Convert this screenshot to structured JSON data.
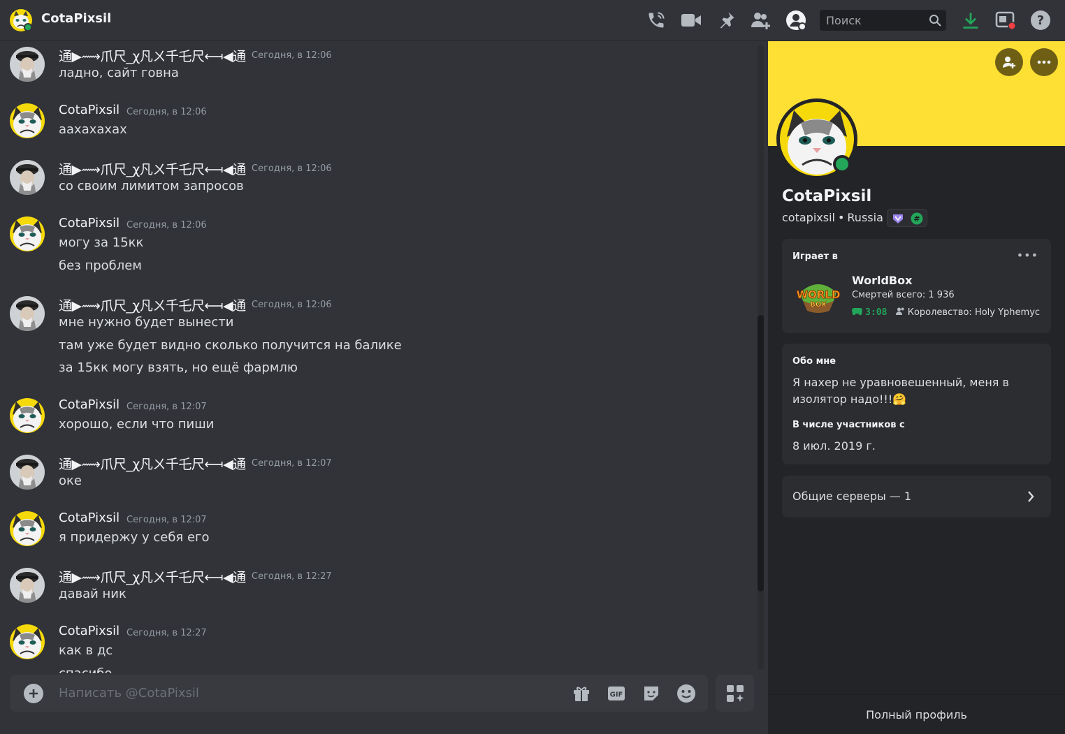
{
  "header": {
    "title": "CotaPixsil",
    "search_placeholder": "Поиск"
  },
  "messages": [
    {
      "author": "通▶⟿爪尺_χ凡ㄨ千乇尺⟻◀通",
      "fancy": true,
      "avatar": "user-photo",
      "timestamp": "Сегодня, в 12:06",
      "lines": [
        "ладно, сайт говна"
      ]
    },
    {
      "author": "CotaPixsil",
      "fancy": false,
      "avatar": "grumpy-cat",
      "timestamp": "Сегодня, в 12:06",
      "lines": [
        "аахахахах"
      ]
    },
    {
      "author": "通▶⟿爪尺_χ凡ㄨ千乇尺⟻◀通",
      "fancy": true,
      "avatar": "user-photo",
      "timestamp": "Сегодня, в 12:06",
      "lines": [
        "со своим лимитом запросов"
      ]
    },
    {
      "author": "CotaPixsil",
      "fancy": false,
      "avatar": "grumpy-cat",
      "timestamp": "Сегодня, в 12:06",
      "lines": [
        "могу за 15кк",
        "без проблем"
      ]
    },
    {
      "author": "通▶⟿爪尺_χ凡ㄨ千乇尺⟻◀通",
      "fancy": true,
      "avatar": "user-photo",
      "timestamp": "Сегодня, в 12:06",
      "lines": [
        "мне нужно будет вынести",
        "там уже будет видно сколько получится на балике",
        "за 15кк могу взять, но ещё фармлю"
      ]
    },
    {
      "author": "CotaPixsil",
      "fancy": false,
      "avatar": "grumpy-cat",
      "timestamp": "Сегодня, в 12:07",
      "lines": [
        "хорошо, если что пиши"
      ]
    },
    {
      "author": "通▶⟿爪尺_χ凡ㄨ千乇尺⟻◀通",
      "fancy": true,
      "avatar": "user-photo",
      "timestamp": "Сегодня, в 12:07",
      "lines": [
        "оке"
      ]
    },
    {
      "author": "CotaPixsil",
      "fancy": false,
      "avatar": "grumpy-cat",
      "timestamp": "Сегодня, в 12:07",
      "lines": [
        "я придержу у себя его"
      ]
    },
    {
      "author": "通▶⟿爪尺_χ凡ㄨ千乇尺⟻◀通",
      "fancy": true,
      "avatar": "user-photo",
      "timestamp": "Сегодня, в 12:27",
      "lines": [
        "давай ник"
      ]
    },
    {
      "author": "CotaPixsil",
      "fancy": false,
      "avatar": "grumpy-cat",
      "timestamp": "Сегодня, в 12:27",
      "lines": [
        "как в дс",
        "спасибо"
      ]
    }
  ],
  "composer": {
    "placeholder": "Написать @CotaPixsil"
  },
  "profile": {
    "display_name": "CotaPixsil",
    "username": "cotapixsil",
    "separator": "•",
    "location": "Russia",
    "banner_color": "#fee034",
    "status": "online",
    "activity": {
      "heading": "Играет в",
      "game": "WorldBox",
      "details": "Смертей всего: 1 936",
      "elapsed": "3:08",
      "state": "Королевство: Holy Yphemyc",
      "logo_text": "WORLD BOX"
    },
    "about": {
      "heading": "Обо мне",
      "text_line1": "Я нахер не уравновешенный, меня в",
      "text_line2": "изолятор надо!!!🤗",
      "member_heading": "В числе участников с",
      "member_since": "8 июл. 2019 г."
    },
    "mutual_servers": "Общие серверы — 1",
    "full_profile": "Полный профиль"
  }
}
